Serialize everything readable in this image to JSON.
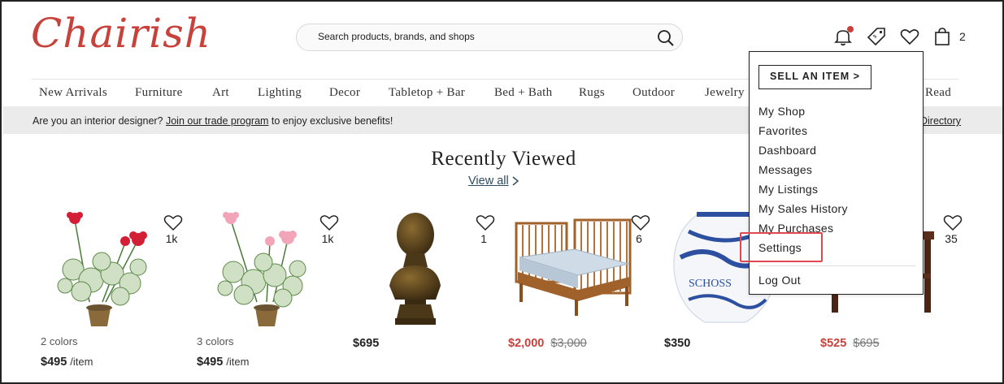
{
  "header": {
    "logo_text": "Chairish",
    "search_placeholder": "Search products, brands, and shops",
    "cart_count": "2",
    "accent_color": "#c8423c"
  },
  "nav": {
    "items": [
      "New Arrivals",
      "Furniture",
      "Art",
      "Lighting",
      "Decor",
      "Tabletop + Bar",
      "Bed + Bath",
      "Rugs",
      "Outdoor",
      "Jewelry",
      "Read"
    ]
  },
  "banner": {
    "prefix": "Are you an interior designer? ",
    "link": "Join our trade program",
    "suffix": " to enjoy exclusive benefits!",
    "right_link": "Directory"
  },
  "recently_viewed": {
    "title": "Recently Viewed",
    "view_all": "View all"
  },
  "products": [
    {
      "name": "geranium-red",
      "likes": "1k",
      "colors": "2 colors",
      "price": "$495",
      "unit": "/item",
      "orig": ""
    },
    {
      "name": "geranium-pink",
      "likes": "1k",
      "colors": "3 colors",
      "price": "$495",
      "unit": "/item",
      "orig": ""
    },
    {
      "name": "bronze-bust",
      "likes": "1",
      "colors": "",
      "price": "$695",
      "unit": "",
      "orig": ""
    },
    {
      "name": "daybed",
      "likes": "6",
      "colors": "",
      "price": "$2,000",
      "unit": "",
      "orig": "$3,000"
    },
    {
      "name": "delft-vase",
      "likes": "",
      "colors": "",
      "price": "$350",
      "unit": "",
      "orig": ""
    },
    {
      "name": "side-table",
      "likes": "35",
      "colors": "",
      "price": "$525",
      "unit": "",
      "orig": "$695"
    }
  ],
  "dropdown": {
    "sell_button": "SELL AN ITEM >",
    "items": [
      "My Shop",
      "Favorites",
      "Dashboard",
      "Messages",
      "My Listings",
      "My Sales History",
      "My Purchases",
      "Settings"
    ],
    "logout": "Log Out"
  }
}
